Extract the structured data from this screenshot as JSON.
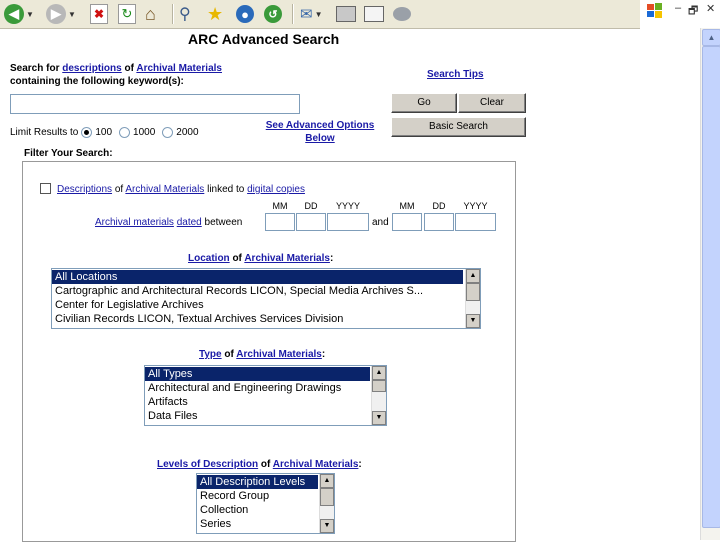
{
  "window": {
    "restore_glyph": "🗗",
    "close_glyph": "✕",
    "minimize_glyph": "–"
  },
  "toolbar": {
    "icons": [
      "back-icon",
      "forward-icon",
      "stop-icon",
      "refresh-icon",
      "home-icon",
      "search-icon",
      "favorites-icon",
      "media-icon",
      "history-icon",
      "mail-icon",
      "print-icon",
      "edit-icon",
      "discuss-icon"
    ]
  },
  "page": {
    "title": "ARC Advanced Search",
    "search_for_prefix": "Search for",
    "search_for_link1": "descriptions",
    "of1": "of",
    "search_for_link2": "Archival Materials",
    "containing": "containing the following keyword(s):",
    "keyword_value": "",
    "search_tips": "Search Tips",
    "go_button": "Go",
    "clear_button": "Clear",
    "basic_search_button": "Basic Search",
    "limit_results_label": "Limit Results to",
    "limit_options": [
      "100",
      "1000",
      "2000"
    ],
    "limit_selected": "100",
    "see_advanced_line1": "See Advanced Options",
    "see_advanced_line2": "Below",
    "filter_label": "Filter Your Search:",
    "digital": {
      "link1": "Descriptions",
      "of": "of",
      "link2": "Archival Materials",
      "linked": "linked to",
      "link3": "digital copies"
    },
    "dated": {
      "link1": "Archival materials",
      "link2": "dated",
      "between": "between",
      "and": "and",
      "mm": "MM",
      "dd": "DD",
      "yyyy": "YYYY"
    },
    "location": {
      "link1": "Location",
      "of": "of",
      "link2": "Archival Materials",
      "colon": ":",
      "options": [
        "All Locations",
        "Cartographic and Architectural Records LICON, Special Media Archives S...",
        "Center for Legislative Archives",
        "Civilian Records LICON, Textual Archives Services Division"
      ]
    },
    "type": {
      "link1": "Type",
      "of": "of",
      "link2": "Archival Materials",
      "colon": ":",
      "options": [
        "All Types",
        "Architectural and Engineering Drawings",
        "Artifacts",
        "Data Files"
      ]
    },
    "levels": {
      "link1": "Levels of Description",
      "of": "of",
      "link2": "Archival Materials",
      "colon": ":",
      "options": [
        "All Description Levels",
        "Record Group",
        "Collection",
        "Series"
      ]
    }
  },
  "colors": {
    "link": "#1a1aa6",
    "selection": "#0a246a",
    "toolbar_bg": "#ece9d8"
  }
}
